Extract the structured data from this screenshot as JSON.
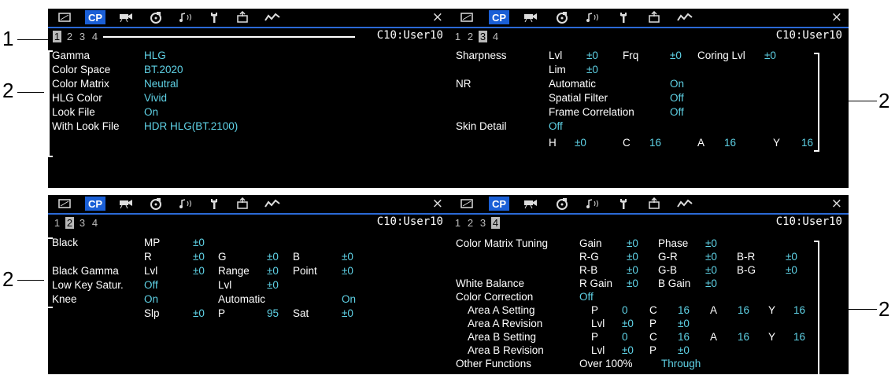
{
  "common": {
    "tab_cp_label": "CP",
    "close_glyph": "×",
    "title": "C10:User10",
    "page_numbers": [
      "1",
      "2",
      "3",
      "4"
    ],
    "accent_color": "#1a5fd6",
    "value_color": "#5fd2e6",
    "tab_icons": [
      "camera-frame-icon",
      "cp-tab",
      "video-camera-icon",
      "media-disc-icon",
      "audio-icon",
      "wrench-icon",
      "assign-icon",
      "waveform-icon"
    ]
  },
  "callouts": {
    "one": "1",
    "two": "2"
  },
  "panel1": {
    "rows": [
      {
        "label": "Gamma",
        "value": "HLG"
      },
      {
        "label": "Color Space",
        "value": "BT.2020"
      },
      {
        "label": "Color Matrix",
        "value": "Neutral"
      },
      {
        "label": "HLG Color",
        "value": "Vivid"
      },
      {
        "label": "Look File",
        "value": "On"
      },
      {
        "label": "With Look File",
        "value": "HDR HLG(BT.2100)"
      }
    ]
  },
  "panel2": {
    "sharpness": "Sharpness",
    "lvl": "Lvl",
    "lvl_val": "±0",
    "frq": "Frq",
    "frq_val": "±0",
    "coring": "Coring Lvl",
    "coring_val": "±0",
    "lim": "Lim",
    "lim_val": "±0",
    "nr": "NR",
    "automatic": "Automatic",
    "automatic_val": "On",
    "spatial": "Spatial Filter",
    "spatial_val": "Off",
    "frame": "Frame Correlation",
    "frame_val": "Off",
    "skin": "Skin Detail",
    "skin_val": "Off",
    "h": "H",
    "h_val": "±0",
    "c": "C",
    "c_val": "16",
    "a": "A",
    "a_val": "16",
    "y": "Y",
    "y_val": "16"
  },
  "panel3": {
    "black": "Black",
    "mp": "MP",
    "mp_val": "±0",
    "r": "R",
    "r_val": "±0",
    "g": "G",
    "g_val": "±0",
    "b": "B",
    "b_val": "±0",
    "black_gamma": "Black Gamma",
    "lvl": "Lvl",
    "lvl_val": "±0",
    "range": "Range",
    "range_val": "±0",
    "point": "Point",
    "point_val": "±0",
    "low_key": "Low Key Satur.",
    "low_key_val": "Off",
    "lvl2": "Lvl",
    "lvl2_val": "±0",
    "knee": "Knee",
    "knee_val": "On",
    "automatic": "Automatic",
    "automatic_val": "On",
    "slp": "Slp",
    "slp_val": "±0",
    "p": "P",
    "p_val": "95",
    "sat": "Sat",
    "sat_val": "±0"
  },
  "panel4": {
    "cmt": "Color Matrix Tuning",
    "gain": "Gain",
    "gain_val": "±0",
    "phase": "Phase",
    "phase_val": "±0",
    "rg": "R-G",
    "rg_val": "±0",
    "gr": "G-R",
    "gr_val": "±0",
    "br": "B-R",
    "br_val": "±0",
    "rb": "R-B",
    "rb_val": "±0",
    "gb": "G-B",
    "gb_val": "±0",
    "bg": "B-G",
    "bg_val": "±0",
    "wb": "White Balance",
    "rgain": "R Gain",
    "rgain_val": "±0",
    "bgain": "B Gain",
    "bgain_val": "±0",
    "cc": "Color Correction",
    "cc_val": "Off",
    "aas": "Area A Setting",
    "aas_p": "P",
    "aas_p_val": "0",
    "aas_c": "C",
    "aas_c_val": "16",
    "aas_a": "A",
    "aas_a_val": "16",
    "aas_y": "Y",
    "aas_y_val": "16",
    "aar": "Area A Revision",
    "aar_lvl": "Lvl",
    "aar_lvl_val": "±0",
    "aar_p": "P",
    "aar_p_val": "±0",
    "abs": "Area B Setting",
    "abs_p": "P",
    "abs_p_val": "0",
    "abs_c": "C",
    "abs_c_val": "16",
    "abs_a": "A",
    "abs_a_val": "16",
    "abs_y": "Y",
    "abs_y_val": "16",
    "abr": "Area B Revision",
    "abr_lvl": "Lvl",
    "abr_lvl_val": "±0",
    "abr_p": "P",
    "abr_p_val": "±0",
    "other": "Other Functions",
    "over": "Over 100%",
    "over_val": "Through"
  }
}
